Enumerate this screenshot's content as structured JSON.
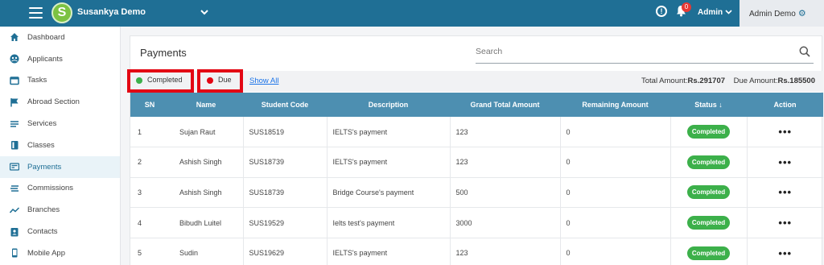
{
  "topbar": {
    "app_title": "Susankya Demo",
    "logo_letter": "S",
    "notification_count": "0",
    "admin_label": "Admin",
    "admin_demo_label": "Admin Demo",
    "colors": {
      "topbar": "#1f6f95",
      "logo": "#7cc242",
      "badge": "#e53935"
    }
  },
  "sidebar": {
    "items": [
      {
        "label": "Dashboard",
        "icon": "home-icon"
      },
      {
        "label": "Applicants",
        "icon": "people-icon"
      },
      {
        "label": "Tasks",
        "icon": "tasks-icon"
      },
      {
        "label": "Abroad Section",
        "icon": "flag-icon"
      },
      {
        "label": "Services",
        "icon": "list-icon"
      },
      {
        "label": "Classes",
        "icon": "book-icon"
      },
      {
        "label": "Payments",
        "icon": "payment-icon",
        "active": true
      },
      {
        "label": "Commissions",
        "icon": "commission-icon"
      },
      {
        "label": "Branches",
        "icon": "trend-icon"
      },
      {
        "label": "Contacts",
        "icon": "contacts-icon"
      },
      {
        "label": "Mobile App",
        "icon": "mobile-icon"
      }
    ]
  },
  "main": {
    "title": "Payments",
    "search_placeholder": "Search",
    "filters": {
      "completed": "Completed",
      "due": "Due",
      "show_all": "Show All",
      "completed_color": "#3cb04a",
      "due_color": "#e30613"
    },
    "totals": {
      "total_label": "Total Amount:",
      "total_value": "Rs.291707",
      "due_label": "Due Amount:",
      "due_value": "Rs.185500"
    },
    "table": {
      "headers": [
        "SN",
        "Name",
        "Student Code",
        "Description",
        "Grand Total Amount",
        "Remaining Amount",
        "Status",
        "Action"
      ],
      "sort_arrow": "↓",
      "rows": [
        {
          "sn": "1",
          "name": "Sujan Raut",
          "code": "SUS18519",
          "desc": "IELTS's payment",
          "grand": "123",
          "remaining": "0",
          "status": "Completed"
        },
        {
          "sn": "2",
          "name": "Ashish Singh",
          "code": "SUS18739",
          "desc": "IELTS's payment",
          "grand": "123",
          "remaining": "0",
          "status": "Completed"
        },
        {
          "sn": "3",
          "name": "Ashish Singh",
          "code": "SUS18739",
          "desc": "Bridge Course's payment",
          "grand": "500",
          "remaining": "0",
          "status": "Completed"
        },
        {
          "sn": "4",
          "name": "Bibudh Luitel",
          "code": "SUS19529",
          "desc": "Ielts test's payment",
          "grand": "3000",
          "remaining": "0",
          "status": "Completed"
        },
        {
          "sn": "5",
          "name": "Sudin",
          "code": "SUS19629",
          "desc": "IELTS's payment",
          "grand": "123",
          "remaining": "0",
          "status": "Completed"
        }
      ],
      "action_glyph": "•••"
    }
  }
}
